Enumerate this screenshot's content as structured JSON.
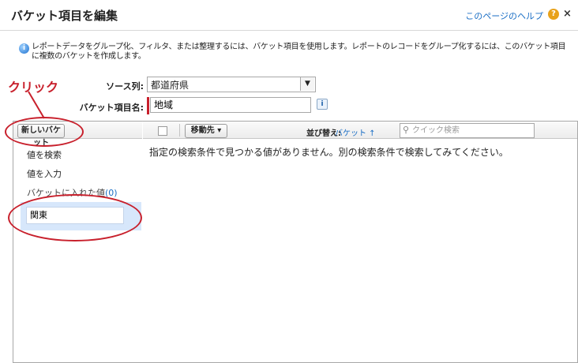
{
  "header": {
    "title": "バケット項目を編集",
    "help_link": "このページのヘルプ",
    "help_icon_glyph": "?",
    "close_glyph": "×"
  },
  "info": {
    "icon_glyph": "i",
    "text": "レポートデータをグループ化、フィルタ、または整理するには、バケット項目を使用します。レポートのレコードをグループ化するには、このバケット項目に複数のバケットを作成します。"
  },
  "annotation": {
    "click_label": "クリック",
    "color": "#c8202c"
  },
  "form": {
    "source_label": "ソース列:",
    "source_value": "都道府県",
    "bucket_field_label": "バケット項目名:",
    "bucket_field_value": "地域",
    "info_glyph": "i"
  },
  "left_panel": {
    "new_bucket_button": "新しいバケット",
    "search_values": "値を検索",
    "enter_value": "値を入力",
    "bucketed_label": "バケットに入れた値",
    "bucketed_count": "(0)",
    "bucket_item": "関東"
  },
  "right_panel": {
    "move_to_button": "移動先 ▾",
    "sort_label": "並び替え:",
    "sort_value": "バケット ↑",
    "search_glyph": "🔍",
    "search_placeholder": "クイック検索",
    "no_results": "指定の検索条件で見つかる値がありません。別の検索条件で検索してみてください。"
  },
  "colors": {
    "accent": "#1a6ec5",
    "selected_bucket": "#d7e7fb",
    "help_icon": "#e8a21b"
  }
}
